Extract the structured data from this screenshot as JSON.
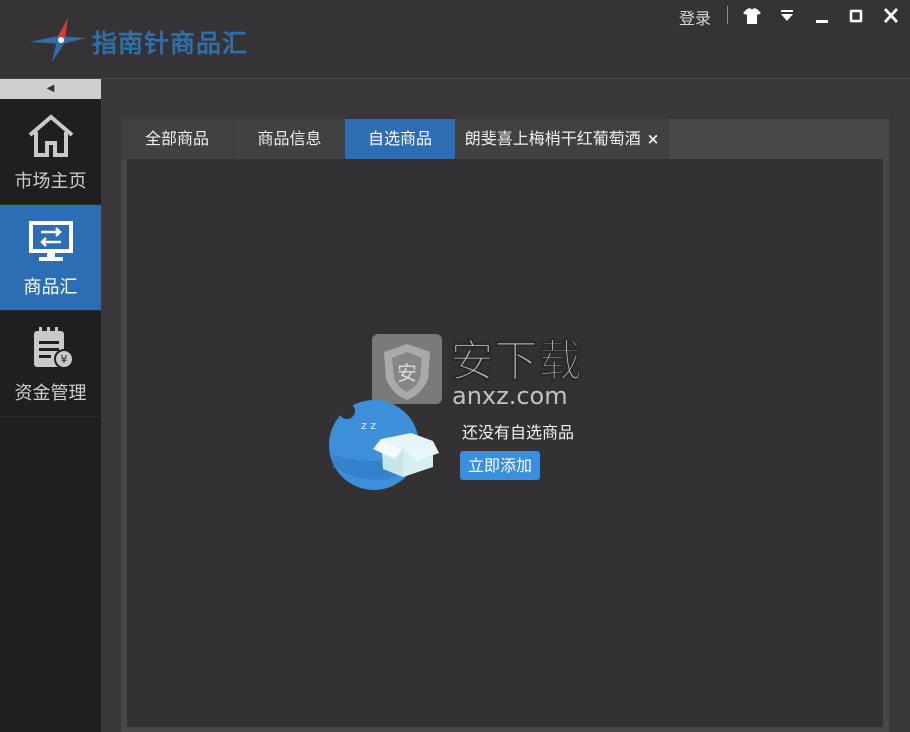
{
  "app": {
    "title": "指南针商品汇"
  },
  "titlebar": {
    "login_label": "登录",
    "controls": [
      "shirt-icon",
      "dropdown-icon",
      "minimize-icon",
      "maximize-icon",
      "close-icon"
    ]
  },
  "sidebar": {
    "collapse_icon": "◀",
    "items": [
      {
        "label": "市场主页",
        "icon": "home-icon",
        "active": false
      },
      {
        "label": "商品汇",
        "icon": "monitor-exchange-icon",
        "active": true
      },
      {
        "label": "资金管理",
        "icon": "funds-notepad-icon",
        "active": false
      }
    ]
  },
  "tabs": [
    {
      "label": "全部商品",
      "active": false
    },
    {
      "label": "商品信息",
      "active": false
    },
    {
      "label": "自选商品",
      "active": true
    },
    {
      "label": "朗斐喜上梅梢干红葡萄酒",
      "active": false,
      "close": "×"
    }
  ],
  "watermark": {
    "brand": "安下载",
    "domain": "anxz.com",
    "shield_char": "安"
  },
  "empty_state": {
    "message": "还没有自选商品",
    "button_label": "立即添加",
    "zz": "z z"
  },
  "colors": {
    "accent": "#2d6db3",
    "button": "#3a8ee0",
    "background": "#353336"
  }
}
